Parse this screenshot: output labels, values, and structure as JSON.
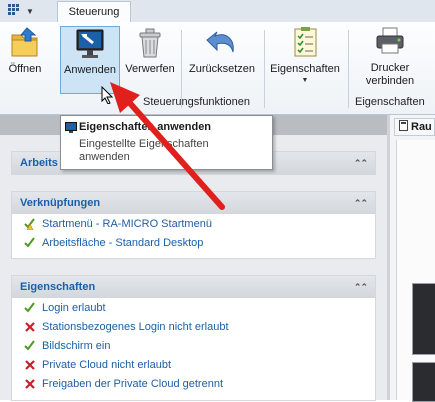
{
  "tabbar": {
    "tab_label": "Steuerung",
    "app_menu_icon": "grid-dropdown-icon"
  },
  "ribbon": {
    "buttons": [
      {
        "label": "Öffnen",
        "icon": "open-folder-icon"
      },
      {
        "label": "Anwenden",
        "icon": "apply-monitor-icon"
      },
      {
        "label": "Verwerfen",
        "icon": "trash-bin-icon"
      },
      {
        "label": "Zurücksetzen",
        "icon": "undo-arrow-icon"
      },
      {
        "label": "Eigenschaften",
        "icon": "properties-checklist-icon"
      },
      {
        "label": "Drucker verbinden",
        "line1": "Drucker",
        "line2": "verbinden",
        "icon": "printer-icon"
      }
    ],
    "group_labels": {
      "steuerung": "Steuerungsfunktionen",
      "eigenschaften": "Eigenschaften"
    }
  },
  "tooltip": {
    "title": "Eigenschaften anwenden",
    "description": "Eingestellte Eigenschaften anwenden"
  },
  "sections": {
    "arbeit": {
      "title": "Arbeits"
    },
    "verknuepfungen": {
      "title": "Verknüpfungen",
      "items": [
        {
          "text": "Startmenü - RA-MICRO Startmenü",
          "status": "warning"
        },
        {
          "text": "Arbeitsfläche - Standard Desktop",
          "status": "ok"
        }
      ]
    },
    "eigenschaften": {
      "title": "Eigenschaften",
      "items": [
        {
          "text": "Login erlaubt",
          "status": "ok"
        },
        {
          "text": "Stationsbezogenes Login nicht erlaubt",
          "status": "error"
        },
        {
          "text": "Bildschirm ein",
          "status": "ok"
        },
        {
          "text": "Private Cloud nicht erlaubt",
          "status": "error"
        },
        {
          "text": "Freigaben der Private Cloud getrennt",
          "status": "error"
        }
      ]
    }
  },
  "right_pane": {
    "tab_label": "Rau"
  },
  "colors": {
    "link": "#1b5fa8",
    "ok": "#4f9a1f",
    "error": "#c8202a",
    "arrow": "#e0201c",
    "selected_bg": "#cde4f7"
  }
}
